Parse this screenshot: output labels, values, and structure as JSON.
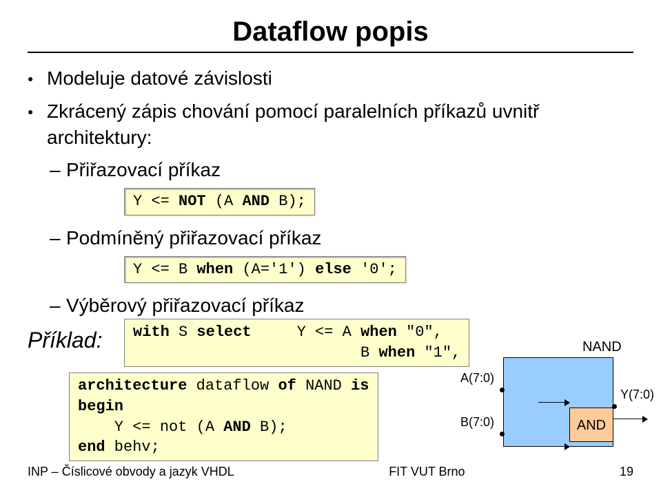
{
  "title": "Dataflow popis",
  "bullets": {
    "b1a": "Modeluje datové závislosti",
    "b1b": "Zkrácený zápis chování pomocí paralelních příkazů  uvnitř architektury:",
    "b2a": "Přiřazovací příkaz",
    "b2b": "Podmíněný přiřazovací příkaz",
    "b2c": "Výběrový přiřazovací příkaz"
  },
  "code": {
    "assign": "Y <= NOT (A AND B);",
    "cond": "Y <= B when (A='1') else '0';",
    "select": "with S select     Y <= A when \"0\",\n                         B when \"1\",",
    "arch": "architecture dataflow of NAND is\nbegin\n    Y <= not (A AND B);\nend behv;"
  },
  "priklad_label": "Příklad:",
  "diagram": {
    "nand": "NAND",
    "and": "AND",
    "a": "A(7:0)",
    "b": "B(7:0)",
    "y": "Y(7:0)"
  },
  "footer": {
    "left": "INP – Číslicové obvody a jazyk VHDL",
    "center": "FIT VUT Brno",
    "right": "19"
  }
}
